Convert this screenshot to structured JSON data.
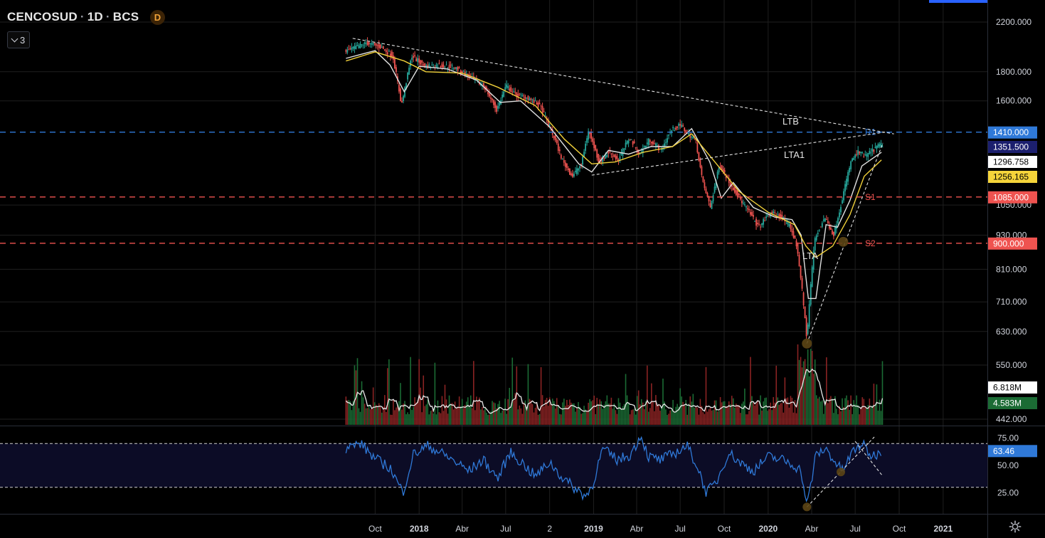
{
  "header": {
    "symbol": "CENCOSUD",
    "interval": "1D",
    "exchange": "BCS",
    "badge": "D",
    "separator": "·"
  },
  "indicator_toggle": {
    "count": "3",
    "icon": "chevron-down-icon"
  },
  "settings": {
    "icon": "gear-icon"
  },
  "colors": {
    "background": "#000000",
    "grid": "#1f1f1f",
    "up": "#26a69a",
    "down": "#ef5350",
    "vol_up": "#1b6b34",
    "vol_down": "#8a2323",
    "ma_fast": "#e0e0e0",
    "ma_slow": "#f0d03a",
    "rsi": "#2f79d8",
    "rsi_band": "#0c0c26",
    "r1": "#2f79d8",
    "support": "#ef5350"
  },
  "chart_data": [
    {
      "type": "line",
      "title": "",
      "xlabel": "",
      "ylabel": "",
      "ylim": [
        420,
        2250
      ],
      "scale": "log",
      "y_ticks": [
        "2200.000",
        "1800.000",
        "1600.000",
        "1050.000",
        "930.000",
        "810.000",
        "710.000",
        "630.000",
        "550.000",
        "442.000"
      ],
      "x_ticks": [
        "Oct",
        "2018",
        "Abr",
        "Jul",
        "2",
        "2019",
        "Abr",
        "Jul",
        "Oct",
        "2020",
        "Abr",
        "Jul",
        "Oct",
        "2021"
      ],
      "x_range": [
        "2017-08-01",
        "2021-01-01"
      ],
      "series": [
        {
          "role": "price",
          "x": [
            "2017-08-01",
            "2017-09-15",
            "2017-10-15",
            "2017-11-10",
            "2017-11-28",
            "2017-12-20",
            "2018-01-15",
            "2018-02-15",
            "2018-03-20",
            "2018-04-20",
            "2018-05-20",
            "2018-06-15",
            "2018-07-05",
            "2018-07-25",
            "2018-08-20",
            "2018-09-15",
            "2018-10-10",
            "2018-11-01",
            "2018-11-20",
            "2018-12-10",
            "2018-12-24",
            "2019-01-15",
            "2019-02-05",
            "2019-02-25",
            "2019-03-20",
            "2019-04-10",
            "2019-05-01",
            "2019-05-25",
            "2019-06-15",
            "2019-07-05",
            "2019-07-20",
            "2019-08-05",
            "2019-08-20",
            "2019-09-05",
            "2019-09-25",
            "2019-10-15",
            "2019-11-05",
            "2019-11-25",
            "2019-12-15",
            "2020-01-10",
            "2020-02-01",
            "2020-02-20",
            "2020-03-05",
            "2020-03-18",
            "2020-03-25",
            "2020-04-10",
            "2020-05-01",
            "2020-05-20",
            "2020-06-05",
            "2020-06-25",
            "2020-07-10",
            "2020-07-25",
            "2020-08-10",
            "2020-08-25"
          ],
          "values": [
            1950,
            2020,
            1990,
            1920,
            1570,
            1920,
            1840,
            1850,
            1830,
            1760,
            1700,
            1540,
            1700,
            1640,
            1620,
            1560,
            1400,
            1250,
            1180,
            1240,
            1420,
            1250,
            1300,
            1260,
            1380,
            1290,
            1370,
            1310,
            1420,
            1450,
            1400,
            1370,
            1150,
            1040,
            1240,
            1150,
            1080,
            1020,
            960,
            1020,
            1000,
            960,
            880,
            700,
            610,
            910,
            1000,
            930,
            1060,
            1250,
            1300,
            1280,
            1310,
            1340
          ]
        },
        {
          "role": "ma_fast",
          "name": "",
          "x": [
            "2017-08-01",
            "2017-10-01",
            "2017-11-01",
            "2017-12-01",
            "2018-01-01",
            "2018-03-01",
            "2018-05-01",
            "2018-06-20",
            "2018-08-01",
            "2018-10-01",
            "2018-12-01",
            "2018-12-28",
            "2019-02-01",
            "2019-03-15",
            "2019-05-01",
            "2019-06-15",
            "2019-07-25",
            "2019-09-01",
            "2019-09-25",
            "2019-10-20",
            "2019-12-01",
            "2020-01-15",
            "2020-02-20",
            "2020-03-10",
            "2020-03-25",
            "2020-04-10",
            "2020-05-01",
            "2020-05-25",
            "2020-06-20",
            "2020-07-15",
            "2020-08-25"
          ],
          "values": [
            1900,
            1960,
            1850,
            1660,
            1840,
            1820,
            1740,
            1590,
            1600,
            1440,
            1240,
            1200,
            1310,
            1290,
            1330,
            1330,
            1430,
            1250,
            1080,
            1150,
            1040,
            1000,
            990,
            930,
            720,
            720,
            970,
            960,
            1070,
            1230,
            1300
          ]
        },
        {
          "role": "ma_slow",
          "name": "",
          "x": [
            "2017-08-01",
            "2017-10-01",
            "2017-12-01",
            "2018-01-15",
            "2018-04-01",
            "2018-06-15",
            "2018-09-01",
            "2018-11-01",
            "2018-12-28",
            "2019-02-15",
            "2019-04-15",
            "2019-06-15",
            "2019-07-25",
            "2019-09-15",
            "2019-11-01",
            "2020-01-01",
            "2020-02-25",
            "2020-03-20",
            "2020-04-10",
            "2020-05-15",
            "2020-06-20",
            "2020-07-20",
            "2020-08-25"
          ],
          "values": [
            1880,
            1950,
            1880,
            1800,
            1790,
            1690,
            1570,
            1370,
            1240,
            1250,
            1300,
            1330,
            1400,
            1240,
            1110,
            1020,
            970,
            890,
            850,
            890,
            1010,
            1180,
            1260
          ]
        }
      ],
      "trendlines": [
        {
          "label": "LTB",
          "x": [
            "2017-08-15",
            "2020-09-20"
          ],
          "y": [
            2060,
            1400
          ]
        },
        {
          "label": "LTA1",
          "x": [
            "2018-12-28",
            "2020-09-01"
          ],
          "y": [
            1185,
            1410
          ]
        },
        {
          "label": "LTA",
          "x": [
            "2020-03-22",
            "2020-08-28"
          ],
          "y": [
            600,
            1350
          ]
        }
      ],
      "pivots": [
        {
          "x": "2020-03-22",
          "y": 600
        },
        {
          "x": "2020-06-06",
          "y": 905
        }
      ],
      "levels": [
        {
          "label": "R1",
          "value": 1410,
          "badge": "1410.000",
          "color": "#2f79d8"
        },
        {
          "label": "S1",
          "value": 1085,
          "badge": "1085.000",
          "color": "#ef5350"
        },
        {
          "label": "S2",
          "value": 900,
          "badge": "900.000",
          "color": "#ef5350"
        }
      ],
      "last_values": [
        {
          "label": "1351.500",
          "value": 1351.5,
          "bg": "#1c1f6e",
          "fg": "#ffffff"
        },
        {
          "label": "1296.758",
          "value": 1296.758,
          "bg": "#ffffff",
          "fg": "#000000"
        },
        {
          "label": "1256.165",
          "value": 1256.165,
          "bg": "#f5d43a",
          "fg": "#000000"
        }
      ]
    },
    {
      "type": "bar",
      "title": "",
      "series": [
        {
          "role": "volume"
        },
        {
          "role": "volume_ma"
        }
      ],
      "last_values": [
        {
          "label": "6.818M",
          "bg": "#ffffff",
          "fg": "#000000"
        },
        {
          "label": "4.583M",
          "bg": "#1b6b34",
          "fg": "#ffffff"
        }
      ]
    },
    {
      "type": "line",
      "title": "",
      "ylim": [
        10,
        85
      ],
      "y_ticks": [
        "75.00",
        "50.00",
        "25.00"
      ],
      "upper_band": 70,
      "lower_band": 30,
      "series": [
        {
          "role": "rsi",
          "x": [
            "2017-08-01",
            "2017-09-01",
            "2017-10-01",
            "2017-11-01",
            "2017-11-28",
            "2017-12-20",
            "2018-01-20",
            "2018-03-01",
            "2018-04-15",
            "2018-05-15",
            "2018-06-15",
            "2018-07-10",
            "2018-08-05",
            "2018-09-01",
            "2018-10-01",
            "2018-10-25",
            "2018-11-20",
            "2018-12-15",
            "2018-12-28",
            "2019-01-20",
            "2019-02-20",
            "2019-03-20",
            "2019-04-10",
            "2019-04-25",
            "2019-05-20",
            "2019-06-15",
            "2019-07-15",
            "2019-08-05",
            "2019-08-25",
            "2019-09-15",
            "2019-10-10",
            "2019-11-05",
            "2019-12-01",
            "2020-01-01",
            "2020-02-01",
            "2020-02-25",
            "2020-03-10",
            "2020-03-22",
            "2020-04-10",
            "2020-05-01",
            "2020-05-25",
            "2020-06-05",
            "2020-06-25",
            "2020-07-15",
            "2020-08-05",
            "2020-08-25"
          ],
          "values": [
            66,
            70,
            56,
            48,
            25,
            60,
            68,
            58,
            45,
            55,
            38,
            62,
            52,
            40,
            53,
            40,
            30,
            22,
            30,
            65,
            55,
            60,
            78,
            58,
            55,
            60,
            68,
            50,
            25,
            35,
            62,
            52,
            45,
            58,
            55,
            50,
            45,
            12,
            60,
            65,
            50,
            45,
            62,
            70,
            58,
            63
          ]
        }
      ],
      "trendlines": [
        {
          "x": [
            "2020-03-22",
            "2020-08-10"
          ],
          "y": [
            12,
            76
          ]
        },
        {
          "x": [
            "2020-07-01",
            "2020-08-28"
          ],
          "y": [
            72,
            40
          ]
        }
      ],
      "pivots": [
        {
          "x": "2020-03-22",
          "y": 12
        },
        {
          "x": "2020-06-01",
          "y": 44
        }
      ],
      "last_values": [
        {
          "label": "63.46",
          "value": 63.46,
          "bg": "#2f79d8",
          "fg": "#ffffff"
        }
      ]
    }
  ]
}
